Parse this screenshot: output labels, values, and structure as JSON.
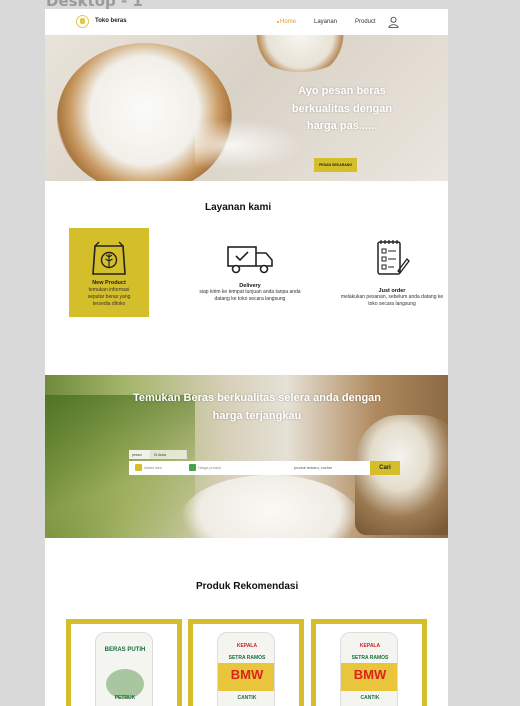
{
  "frame": {
    "label": "Desktop - 1"
  },
  "navbar": {
    "brand": "Toko beras",
    "items": [
      "Home",
      "Layanan",
      "Product"
    ],
    "active": "Home"
  },
  "hero": {
    "title": "Ayo pesan beras berkualitas dengan harga pas......",
    "button_label": "PESAN SEKARANG"
  },
  "layanan": {
    "title": "Layanan kami",
    "services": [
      {
        "name": "New Product",
        "description": "temukan informasi seputar beras yang tersedia ditoko",
        "icon": "rice-sack-icon"
      },
      {
        "name": "Delivery",
        "description": "siap kirim ke tempat tunjuan anda tanpa anda datang ke toko secara langsung",
        "icon": "delivery-truck-icon"
      },
      {
        "name": "Just order",
        "description": "melakukan pesanan, sebelum anda datang ke toko secara langsung",
        "icon": "order-clipboard-icon"
      }
    ]
  },
  "search": {
    "title": "Temukan Beras berkualitas selera anda dengan harga terjangkau",
    "tabs": [
      "pesan",
      "Di Antar"
    ],
    "location_label": "lokasi tuku",
    "price_label": "Harga produk",
    "input_placeholder": "produk terbaru, vocher",
    "button_label": "Cari"
  },
  "produk": {
    "title": "Produk Rekomendasi",
    "items": [
      {
        "top": "",
        "label": "BERAS PUTIH",
        "big": "",
        "foot": "PETRUK"
      },
      {
        "top": "KEPALA",
        "label": "SETRA RAMOS",
        "big": "BMW",
        "foot": "CANTIK"
      },
      {
        "top": "KEPALA",
        "label": "SETRA RAMOS",
        "big": "BMW",
        "foot": "CANTIK"
      }
    ]
  },
  "colors": {
    "accent": "#d4be2a",
    "active_nav": "#e39b2f"
  }
}
